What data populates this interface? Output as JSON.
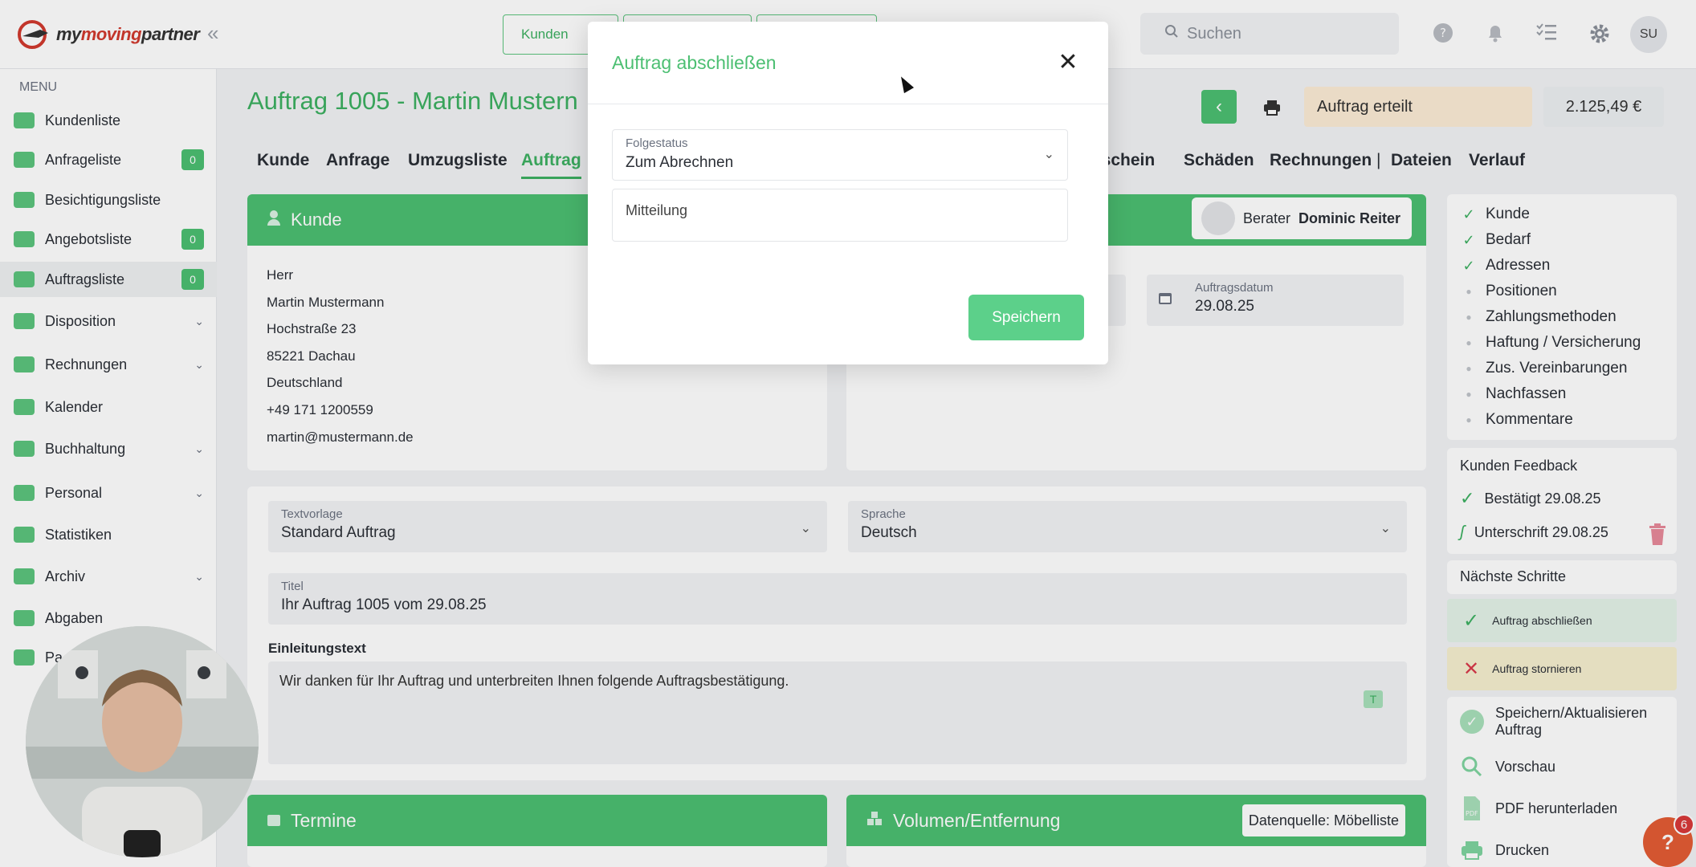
{
  "app": {
    "logo_text_a": "my",
    "logo_text_b": "moving",
    "logo_text_c": "partner"
  },
  "topnav": {
    "items": [
      {
        "label": "Kunden"
      },
      {
        "label": ""
      },
      {
        "label": ""
      }
    ]
  },
  "search": {
    "placeholder": "Suchen"
  },
  "user": {
    "initials": "SU"
  },
  "sidebar": {
    "menu_label": "MENU",
    "items": [
      {
        "label": "Kundenliste"
      },
      {
        "label": "Anfrageliste",
        "badge": "0"
      },
      {
        "label": "Besichtigungsliste"
      },
      {
        "label": "Angebotsliste",
        "badge": "0"
      },
      {
        "label": "Auftragsliste",
        "badge": "0"
      },
      {
        "label": "Disposition"
      },
      {
        "label": "Rechnungen"
      },
      {
        "label": "Kalender"
      },
      {
        "label": "Buchhaltung"
      },
      {
        "label": "Personal"
      },
      {
        "label": "Statistiken"
      },
      {
        "label": "Archiv"
      },
      {
        "label": "Abgaben"
      },
      {
        "label": "Pa"
      }
    ]
  },
  "page": {
    "title": "Auftrag 1005 - Martin Mustern",
    "status": "Auftrag erteilt",
    "amount": "2.125,49 €"
  },
  "tabs": [
    {
      "label": "Kunde"
    },
    {
      "label": "Anfrage"
    },
    {
      "label": "Umzugsliste"
    },
    {
      "label": "Auftrag"
    },
    {
      "label": "sschein"
    },
    {
      "label": "Schäden"
    },
    {
      "label": "Rechnungen"
    },
    {
      "label": "|"
    },
    {
      "label": "Dateien"
    },
    {
      "label": "Verlauf"
    }
  ],
  "kunde": {
    "header": "Kunde",
    "lines": [
      "Herr",
      "Martin Mustermann",
      "Hochstraße 23",
      "85221 Dachau",
      "Deutschland",
      "+49 171 1200559",
      "martin@mustermann.de"
    ]
  },
  "order": {
    "berater_label": "Berater",
    "berater_name": "Dominic Reiter",
    "date_label": "Auftragsdatum",
    "date_value": "29.08.25"
  },
  "text": {
    "template_label": "Textvorlage",
    "template_value": "Standard Auftrag",
    "lang_label": "Sprache",
    "lang_value": "Deutsch",
    "title_label": "Titel",
    "title_value": "Ihr Auftrag 1005 vom 29.08.25",
    "intro_label": "Einleitungstext",
    "intro_value": "Wir danken für Ihr Auftrag und unterbreiten Ihnen folgende Auftragsbestätigung."
  },
  "sections": {
    "termine": "Termine",
    "volumen": "Volumen/Entfernung",
    "datenquelle": "Datenquelle: Möbelliste"
  },
  "checklist": [
    {
      "label": "Kunde",
      "done": true
    },
    {
      "label": "Bedarf",
      "done": true
    },
    {
      "label": "Adressen",
      "done": true
    },
    {
      "label": "Positionen",
      "done": false
    },
    {
      "label": "Zahlungsmethoden",
      "done": false
    },
    {
      "label": "Haftung / Versicherung",
      "done": false
    },
    {
      "label": "Zus. Vereinbarungen",
      "done": false
    },
    {
      "label": "Nachfassen",
      "done": false
    },
    {
      "label": "Kommentare",
      "done": false
    }
  ],
  "feedback": {
    "title": "Kunden Feedback",
    "confirmed": "Bestätigt 29.08.25",
    "signature": "Unterschrift 29.08.25"
  },
  "next_steps": {
    "title": "Nächste Schritte",
    "complete": "Auftrag abschließen",
    "cancel": "Auftrag stornieren"
  },
  "actions": {
    "save": "Speichern/Aktualisieren Auftrag",
    "preview": "Vorschau",
    "pdf": "PDF herunterladen",
    "print": "Drucken"
  },
  "help": {
    "label": "?",
    "count": "6"
  },
  "modal": {
    "title": "Auftrag abschließen",
    "status_label": "Folgestatus",
    "status_value": "Zum Abrechnen",
    "message_placeholder": "Mitteilung",
    "save": "Speichern"
  },
  "colors": {
    "brand": "#4cbf72",
    "accent_text": "#3db061",
    "status_bg": "#fcecd6",
    "cancel_bg": "#f6efcf",
    "complete_bg": "#e3f3e8"
  }
}
